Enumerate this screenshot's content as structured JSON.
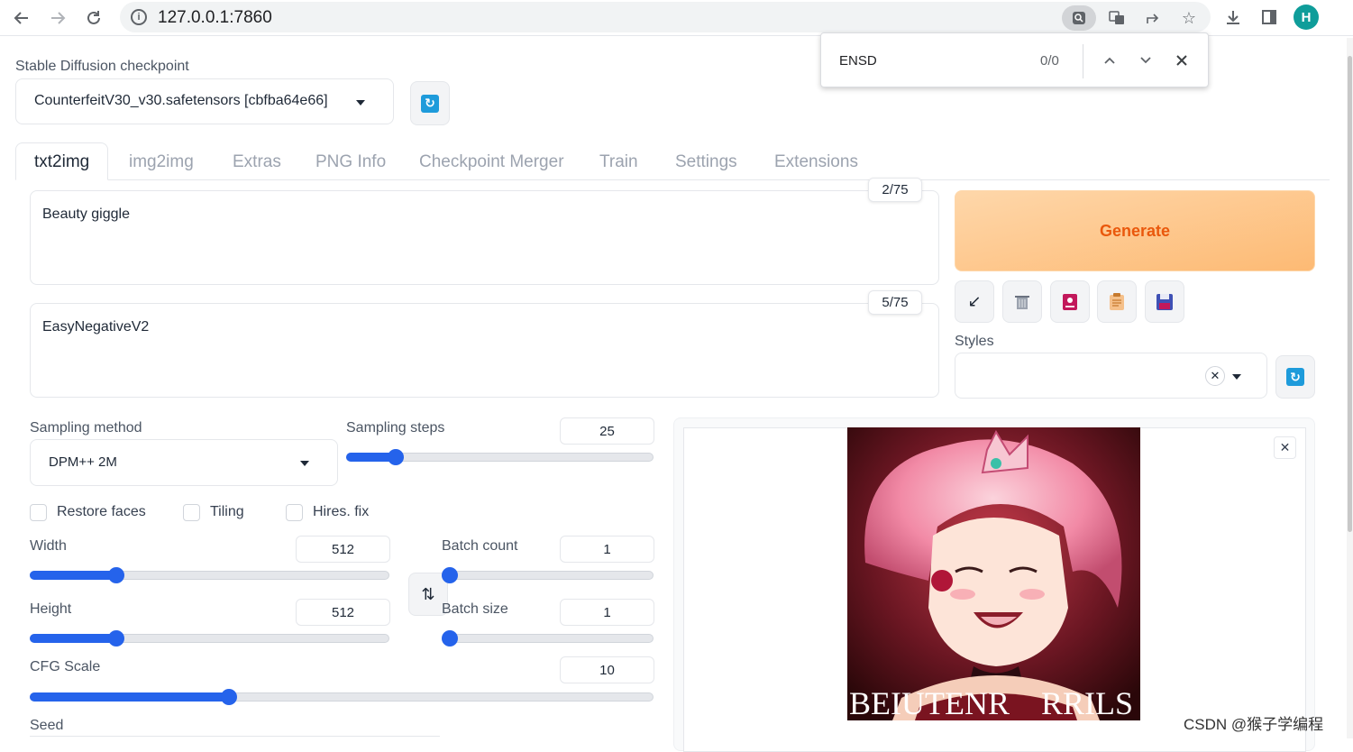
{
  "browser": {
    "url": "127.0.0.1:7860",
    "profile_initial": "H"
  },
  "find_bar": {
    "query": "ENSD",
    "match_count": "0/0"
  },
  "checkpoint": {
    "label": "Stable Diffusion checkpoint",
    "value": "CounterfeitV30_v30.safetensors [cbfba64e66]"
  },
  "tabs": [
    {
      "label": "txt2img",
      "active": true
    },
    {
      "label": "img2img"
    },
    {
      "label": "Extras"
    },
    {
      "label": "PNG Info"
    },
    {
      "label": "Checkpoint Merger"
    },
    {
      "label": "Train"
    },
    {
      "label": "Settings"
    },
    {
      "label": "Extensions"
    }
  ],
  "prompt": {
    "text": "Beauty giggle",
    "token_count": "2/75"
  },
  "negative_prompt": {
    "text": "EasyNegativeV2",
    "token_count": "5/75"
  },
  "generate_label": "Generate",
  "styles_label": "Styles",
  "sampling": {
    "method_label": "Sampling method",
    "method_value": "DPM++ 2M",
    "steps_label": "Sampling steps",
    "steps_value": "25",
    "steps_fraction": 0.16
  },
  "checkboxes": {
    "restore_faces": "Restore faces",
    "tiling": "Tiling",
    "hires_fix": "Hires. fix"
  },
  "width": {
    "label": "Width",
    "value": "512",
    "fraction": 0.24
  },
  "height": {
    "label": "Height",
    "value": "512",
    "fraction": 0.24
  },
  "batch_count": {
    "label": "Batch count",
    "value": "1",
    "fraction": 0.0
  },
  "batch_size": {
    "label": "Batch size",
    "value": "1",
    "fraction": 0.0
  },
  "cfg_scale": {
    "label": "CFG Scale",
    "value": "10",
    "fraction": 0.32
  },
  "seed_label": "Seed",
  "image_caption_left": "BEIUTENR",
  "image_caption_right": "RRILS",
  "watermark": "CSDN @猴子学编程",
  "colors": {
    "accent_blue": "#2563eb",
    "generate_orange": "#ea580c"
  }
}
